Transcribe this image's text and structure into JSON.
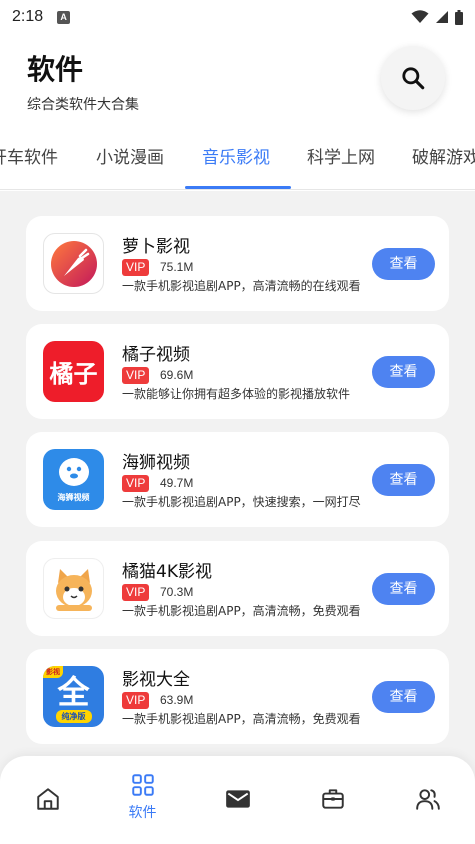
{
  "status_bar": {
    "time": "2:18",
    "notif": "A"
  },
  "header": {
    "title": "软件",
    "subtitle": "综合类软件大合集"
  },
  "tabs": [
    "开车软件",
    "小说漫画",
    "音乐影视",
    "科学上网",
    "破解游戏"
  ],
  "active_tab": "音乐影视",
  "apps": [
    {
      "name": "萝卜影视",
      "badge": "VIP",
      "size": "75.1M",
      "desc": "一款手机影视追剧APP，高清流畅的在线观看",
      "button": "查看",
      "icon": "radish-icon"
    },
    {
      "name": "橘子视频",
      "badge": "VIP",
      "size": "69.6M",
      "desc": "一款能够让你拥有超多体验的影视播放软件",
      "button": "查看",
      "icon": "orange-icon",
      "icon_text": "橘子"
    },
    {
      "name": "海狮视频",
      "badge": "VIP",
      "size": "49.7M",
      "desc": "一款手机影视追剧APP，快速搜索，一网打尽",
      "button": "查看",
      "icon": "sea-lion-icon",
      "icon_text": "海狮视频"
    },
    {
      "name": "橘猫4K影视",
      "badge": "VIP",
      "size": "70.3M",
      "desc": "一款手机影视追剧APP，高清流畅，免费观看",
      "button": "查看",
      "icon": "cat-icon"
    },
    {
      "name": "影视大全",
      "badge": "VIP",
      "size": "63.9M",
      "desc": "一款手机影视追剧APP，高清流畅，免费观看",
      "button": "查看",
      "icon": "quan-icon",
      "icon_text": "全",
      "icon_tag": "纯净版",
      "icon_corner": "影视"
    }
  ],
  "bottom_nav": {
    "items": [
      "home-icon",
      "grid-icon",
      "mail-icon",
      "briefcase-icon",
      "users-icon"
    ],
    "active_label": "软件"
  },
  "colors": {
    "accent": "#3b7bf6",
    "button": "#4e83f1",
    "vip": "#ee3b3b",
    "background": "#f2f2f2"
  }
}
